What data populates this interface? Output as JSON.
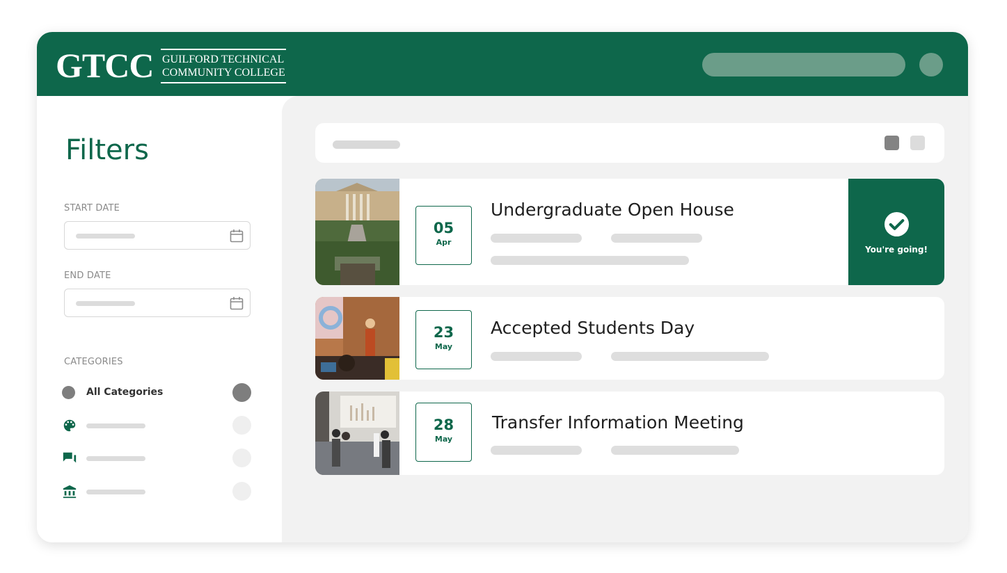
{
  "header": {
    "logo_main": "GTCC",
    "logo_sub_line1": "GUILFORD TECHNICAL",
    "logo_sub_line2": "COMMUNITY COLLEGE",
    "brand_color": "#0e674b"
  },
  "sidebar": {
    "title": "Filters",
    "start_date_label": "START DATE",
    "end_date_label": "END DATE",
    "start_date_icon": "calendar-icon",
    "end_date_icon": "calendar-icon",
    "categories_label": "CATEGORIES",
    "categories": [
      {
        "label": "All Categories",
        "icon": "circle-icon",
        "selected": true
      },
      {
        "label": "",
        "icon": "palette-icon",
        "selected": false
      },
      {
        "label": "",
        "icon": "chat-icon",
        "selected": false
      },
      {
        "label": "",
        "icon": "bank-icon",
        "selected": false
      }
    ]
  },
  "toolbar": {
    "view_icons": [
      "grid-view-icon",
      "list-view-icon"
    ]
  },
  "events": [
    {
      "day": "05",
      "month": "Apr",
      "title": "Undergraduate Open House",
      "going": true,
      "going_label": "You're going!",
      "photo": "campus-photo"
    },
    {
      "day": "23",
      "month": "May",
      "title": "Accepted Students Day",
      "going": false,
      "photo": "classroom-photo"
    },
    {
      "day": "28",
      "month": "May",
      "title": "Transfer Information Meeting",
      "going": false,
      "photo": "lecture-hall-photo"
    }
  ]
}
